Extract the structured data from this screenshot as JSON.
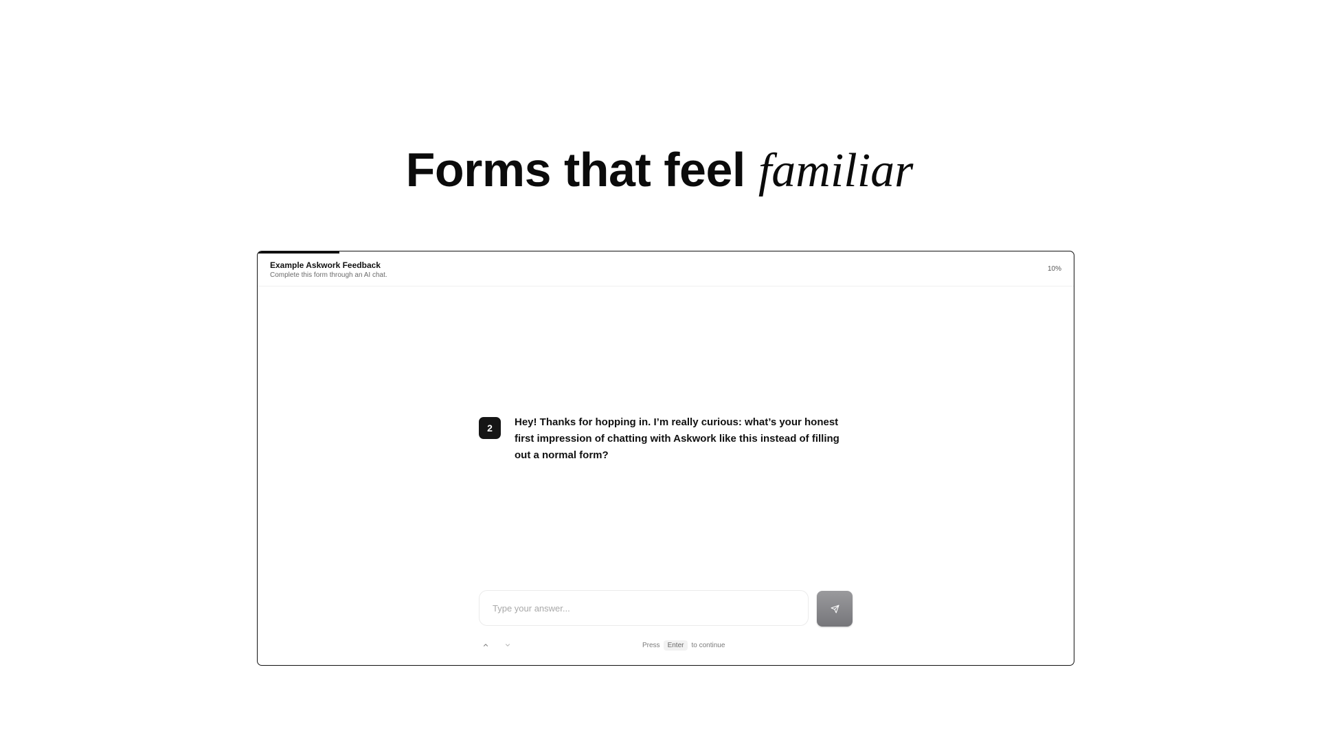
{
  "hero": {
    "title_main": "Forms that feel ",
    "title_accent": "familiar"
  },
  "form": {
    "title": "Example Askwork Feedback",
    "subtitle": "Complete this form through an AI chat.",
    "progress_label": "10%",
    "progress_value": 0.1
  },
  "question": {
    "number": "2",
    "text": "Hey! Thanks for hopping in. I’m really curious: what’s your honest first impression of chatting with Askwork like this instead of filling out a normal form?"
  },
  "answer": {
    "value": "",
    "placeholder": "Type your answer..."
  },
  "footer": {
    "hint_before": "Press",
    "hint_key": "Enter",
    "hint_after": "to continue"
  },
  "icons": {
    "send": "send-icon",
    "prev": "chevron-up-icon",
    "next": "chevron-down-icon"
  },
  "colors": {
    "accent": "#111111",
    "send_button": "#88888b",
    "badge": "#151515"
  }
}
